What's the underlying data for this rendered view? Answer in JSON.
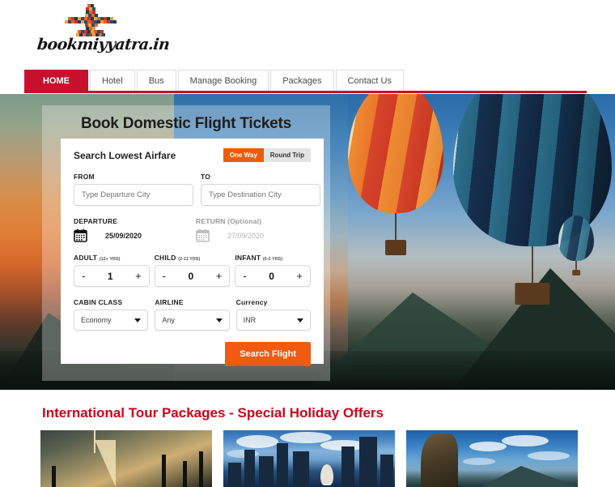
{
  "site": {
    "logo_text": "bookmiyyatra.in",
    "logo_icon": "airplane-mosaic-icon"
  },
  "nav": {
    "items": [
      {
        "label": "HOME",
        "active": true
      },
      {
        "label": "Hotel",
        "active": false
      },
      {
        "label": "Bus",
        "active": false
      },
      {
        "label": "Manage Booking",
        "active": false
      },
      {
        "label": "Packages",
        "active": false
      },
      {
        "label": "Contact Us",
        "active": false
      }
    ],
    "active_color": "#c8102e"
  },
  "hero": {
    "title": "Book Domestic Flight Tickets",
    "background": "hot-air-balloons-over-mountains-at-sunset"
  },
  "search_form": {
    "title": "Search Lowest Airfare",
    "trip_type": {
      "one_way_label": "One Way",
      "round_trip_label": "Round Trip",
      "selected": "One Way",
      "selected_color": "#ea5c0b",
      "unselected_color": "#e3e3e3"
    },
    "from": {
      "label": "FROM",
      "placeholder": "Type Departure City",
      "value": ""
    },
    "to": {
      "label": "TO",
      "placeholder": "Type Destination City",
      "value": ""
    },
    "departure": {
      "label": "DEPARTURE",
      "date": "25/09/2020",
      "icon": "calendar-icon"
    },
    "return": {
      "label": "RETURN (Optional)",
      "date": "27/09/2020",
      "icon": "calendar-icon"
    },
    "passengers": [
      {
        "label": "ADULT",
        "age_note": "(12+ YRS)",
        "count": "1",
        "minus": "-",
        "plus": "+"
      },
      {
        "label": "CHILD",
        "age_note": "(2-11 YRS)",
        "count": "0",
        "minus": "-",
        "plus": "+"
      },
      {
        "label": "INFANT",
        "age_note": "(0-2 YRS)",
        "count": "0",
        "minus": "-",
        "plus": "+"
      }
    ],
    "selects": [
      {
        "label": "CABIN CLASS",
        "value": "Economy"
      },
      {
        "label": "AIRLINE",
        "value": "Any"
      },
      {
        "label": "Currency",
        "value": "INR"
      }
    ],
    "submit_label": "Search Flight",
    "submit_color": "#f05a13"
  },
  "packages": {
    "title": "International Tour Packages - Special Holiday Offers",
    "title_color": "#d0021b",
    "cards": [
      {
        "image": "dubai-burj-al-arab-at-dusk"
      },
      {
        "image": "singapore-merlion-and-skyline"
      },
      {
        "image": "mountain-cliff-with-clouds"
      }
    ]
  }
}
